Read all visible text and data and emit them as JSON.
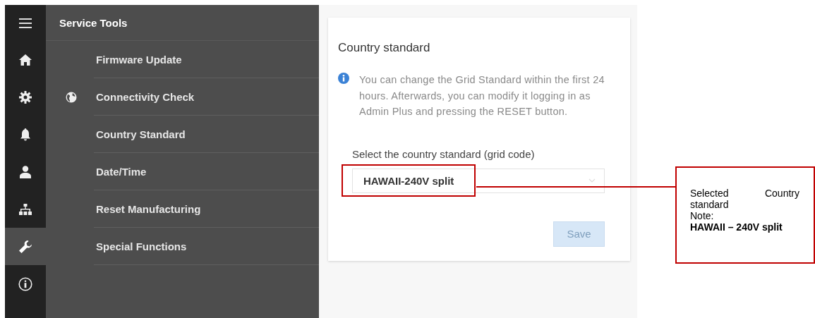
{
  "rail": [
    {
      "selected": false
    },
    {
      "selected": false
    },
    {
      "selected": false
    },
    {
      "selected": false
    },
    {
      "selected": false
    },
    {
      "selected": true
    },
    {
      "selected": false
    }
  ],
  "menu": {
    "title": "Service Tools",
    "items": [
      {
        "label": "Firmware Update",
        "kind": "plain"
      },
      {
        "label": "Connectivity Check",
        "kind": "globe"
      },
      {
        "label": "Country Standard",
        "kind": "plain"
      },
      {
        "label": "Date/Time",
        "kind": "plain"
      },
      {
        "label": "Reset Manufacturing",
        "kind": "plain"
      },
      {
        "label": "Special Functions",
        "kind": "plain"
      }
    ]
  },
  "card": {
    "title": "Country standard",
    "info": "You can change the Grid Standard within the first 24 hours. Afterwards, you can modify it logging in as Admin Plus and pressing the RESET button.",
    "select_label": "Select the country standard (grid code)",
    "select_value": "HAWAII-240V split",
    "save": "Save"
  },
  "callout": {
    "text": "Selected Country standard",
    "note_label": "Note:",
    "note": "HAWAII – 240V split"
  }
}
